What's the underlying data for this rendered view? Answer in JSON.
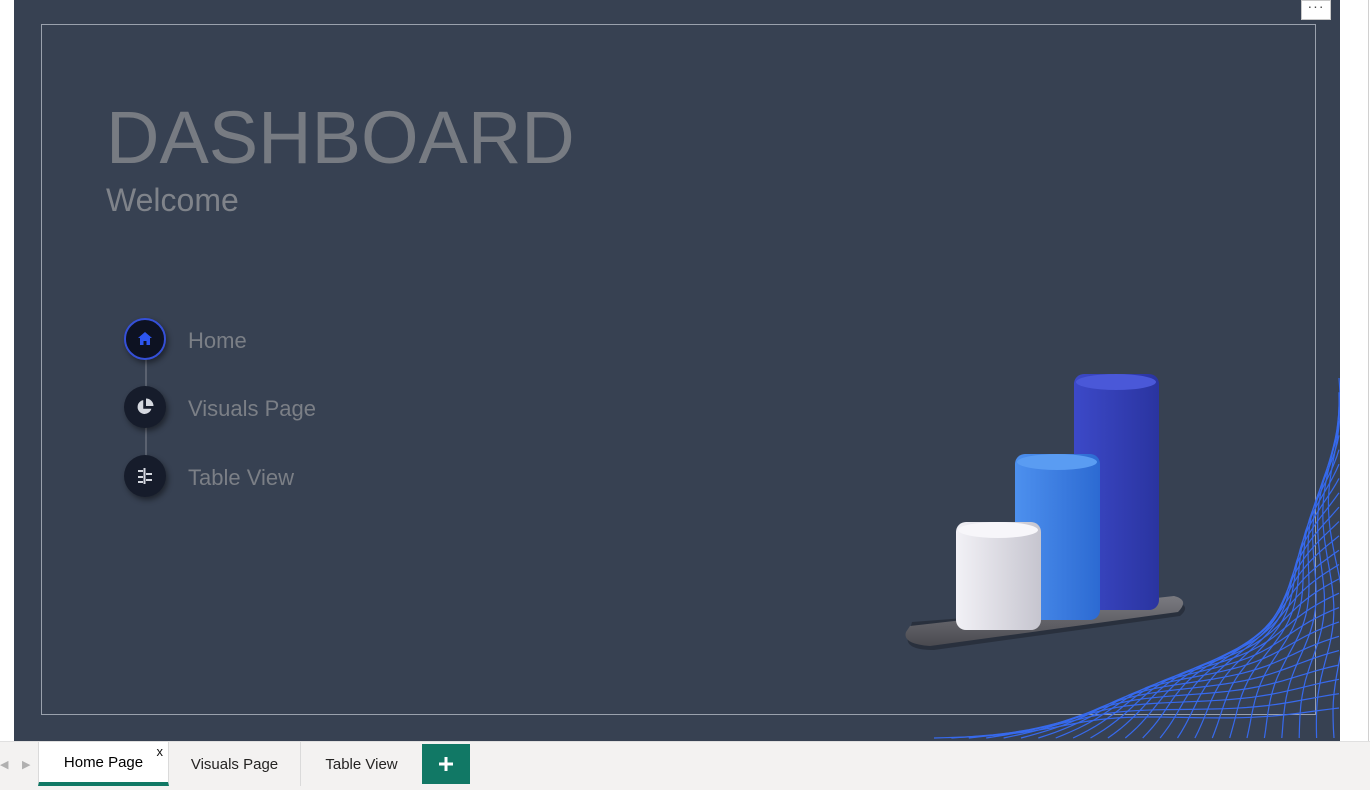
{
  "header": {
    "title": "DASHBOARD",
    "subtitle": "Welcome"
  },
  "menu": {
    "more_label": "···"
  },
  "nav": {
    "items": [
      {
        "label": "Home",
        "icon": "home-icon",
        "active": true
      },
      {
        "label": "Visuals Page",
        "icon": "pie-chart-icon",
        "active": false
      },
      {
        "label": "Table View",
        "icon": "table-icon",
        "active": false
      }
    ]
  },
  "tabs": {
    "items": [
      {
        "label": "Home Page",
        "active": true,
        "close_label": "x"
      },
      {
        "label": "Visuals Page",
        "active": false
      },
      {
        "label": "Table View",
        "active": false
      }
    ],
    "add_icon": "plus-icon",
    "nav_prev_icon": "chevron-left-icon",
    "nav_next_icon": "chevron-right-icon"
  },
  "colors": {
    "canvas_bg": "#374152",
    "accent": "#117865",
    "active_nav_ring": "#3550d8",
    "bar_white": "#e0dfe6",
    "bar_light_blue": "#3f82e0",
    "bar_dark_blue": "#3540b8"
  }
}
